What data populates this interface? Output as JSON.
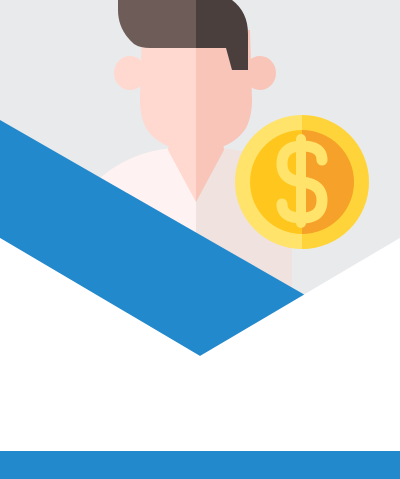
{
  "illustration": {
    "subject": "person-with-dollar-coin",
    "icons": [
      "person-avatar-icon",
      "dollar-coin-icon"
    ]
  },
  "colors": {
    "background": "#ffffff",
    "hexagon_fill": "#e9eaec",
    "accent_blue": "#2389cd",
    "hair_dark": "#4a3f3d",
    "hair_light": "#6e5c58",
    "skin_light": "#ffd8cf",
    "skin_shade": "#f8c5b8",
    "shirt_light": "#fff2f2",
    "shirt_shade": "#efe2df",
    "coin_outer": "#ffe36b",
    "coin_outer_shade": "#ffd43a",
    "coin_inner": "#ffc61e",
    "coin_inner_shade": "#f6a12a"
  }
}
